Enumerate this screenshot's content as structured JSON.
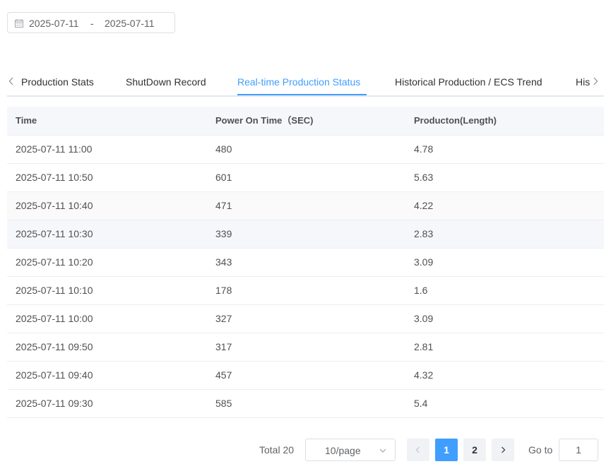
{
  "date_range": {
    "start": "2025-07-11",
    "separator": "-",
    "end": "2025-07-11"
  },
  "tabs": [
    {
      "label": "Production Stats",
      "active": false
    },
    {
      "label": "ShutDown Record",
      "active": false
    },
    {
      "label": "Real-time Production Status",
      "active": true
    },
    {
      "label": "Historical Production / ECS Trend",
      "active": false
    },
    {
      "label": "His",
      "active": false
    }
  ],
  "table": {
    "columns": [
      "Time",
      "Power On Time（SEC)",
      "Producton(Length)"
    ],
    "rows": [
      [
        "2025-07-11 11:00",
        "480",
        "4.78"
      ],
      [
        "2025-07-11 10:50",
        "601",
        "5.63"
      ],
      [
        "2025-07-11 10:40",
        "471",
        "4.22"
      ],
      [
        "2025-07-11 10:30",
        "339",
        "2.83"
      ],
      [
        "2025-07-11 10:20",
        "343",
        "3.09"
      ],
      [
        "2025-07-11 10:10",
        "178",
        "1.6"
      ],
      [
        "2025-07-11 10:00",
        "327",
        "3.09"
      ],
      [
        "2025-07-11 09:50",
        "317",
        "2.81"
      ],
      [
        "2025-07-11 09:40",
        "457",
        "4.32"
      ],
      [
        "2025-07-11 09:30",
        "585",
        "5.4"
      ]
    ]
  },
  "pagination": {
    "total_label": "Total 20",
    "page_size_label": "10/page",
    "pages": [
      "1",
      "2"
    ],
    "current_page": "1",
    "goto_label": "Go to",
    "goto_value": "1"
  },
  "colors": {
    "accent": "#409eff",
    "header_bg": "#f5f7fa",
    "border": "#ebeef5"
  }
}
